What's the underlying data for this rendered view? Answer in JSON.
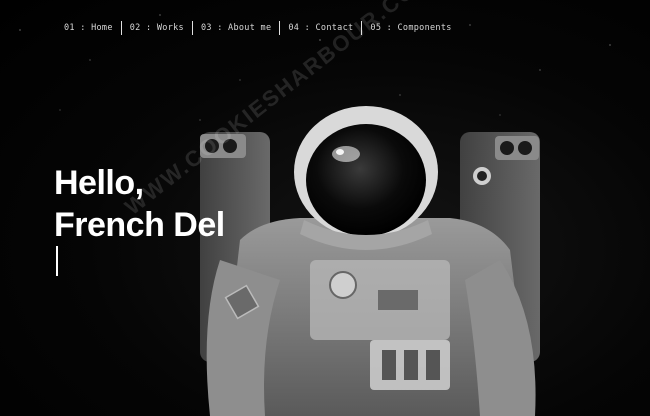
{
  "nav": {
    "items": [
      {
        "label": "01 : Home"
      },
      {
        "label": "02 : Works"
      },
      {
        "label": "03 : About me"
      },
      {
        "label": "04 : Contact"
      },
      {
        "label": "05 : Components"
      }
    ]
  },
  "hero": {
    "line1": "Hello,",
    "line2": "French Del"
  },
  "watermark": "WWW.COOKIESHARBOUR.COM",
  "colors": {
    "background": "#000000",
    "text": "#ffffff",
    "nav_text": "#d8d8d8"
  }
}
